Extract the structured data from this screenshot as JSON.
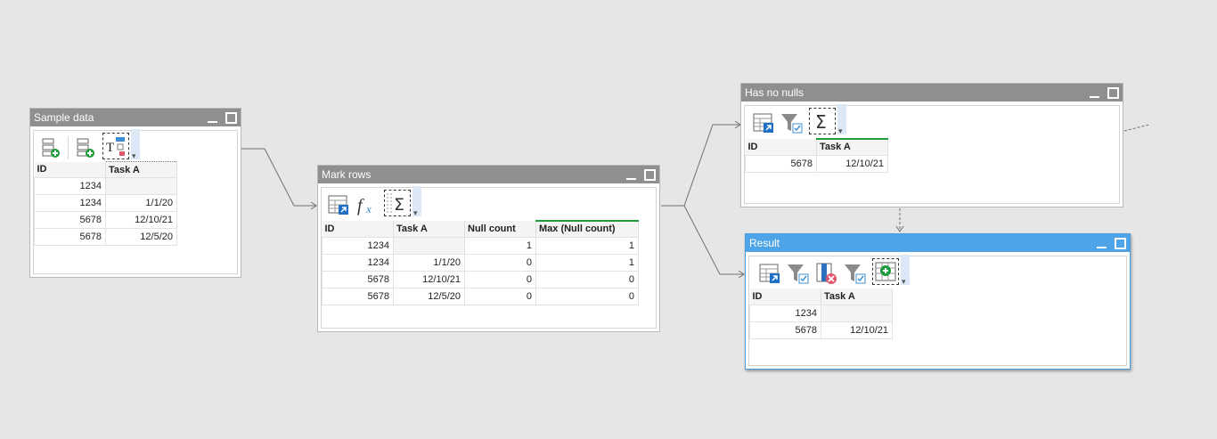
{
  "colors": {
    "canvas": "#e6e6e6",
    "titlebar": "#8f8f8f",
    "titlebar_selected": "#4ea4e6",
    "accent_green": "#1f9d3a"
  },
  "nodes": {
    "sample_data": {
      "title": "Sample data",
      "tools": [
        "add-table-icon",
        "add-row-icon",
        "text-format-icon"
      ],
      "columns": [
        "ID",
        "Task A"
      ],
      "rows": [
        [
          "1234",
          ""
        ],
        [
          "1234",
          "1/1/20"
        ],
        [
          "5678",
          "12/10/21"
        ],
        [
          "5678",
          "12/5/20"
        ]
      ]
    },
    "mark_rows": {
      "title": "Mark rows",
      "tools": [
        "table-link-icon",
        "function-fx-icon",
        "sigma-aggregate-icon"
      ],
      "columns": [
        "ID",
        "Task A",
        "Null count",
        "Max (Null count)"
      ],
      "rows": [
        [
          "1234",
          "",
          "1",
          "1"
        ],
        [
          "1234",
          "1/1/20",
          "0",
          "1"
        ],
        [
          "5678",
          "12/10/21",
          "0",
          "0"
        ],
        [
          "5678",
          "12/5/20",
          "0",
          "0"
        ]
      ]
    },
    "has_no_nulls": {
      "title": "Has no nulls",
      "tools": [
        "table-link-icon",
        "filter-icon",
        "sigma-aggregate-icon"
      ],
      "columns": [
        "ID",
        "Task A"
      ],
      "rows": [
        [
          "5678",
          "12/10/21"
        ]
      ]
    },
    "result": {
      "title": "Result",
      "tools": [
        "table-link-icon",
        "filter-icon",
        "remove-column-icon",
        "filter-icon",
        "add-column-icon"
      ],
      "columns": [
        "ID",
        "Task A"
      ],
      "rows": [
        [
          "1234",
          ""
        ],
        [
          "5678",
          "12/10/21"
        ]
      ]
    }
  }
}
